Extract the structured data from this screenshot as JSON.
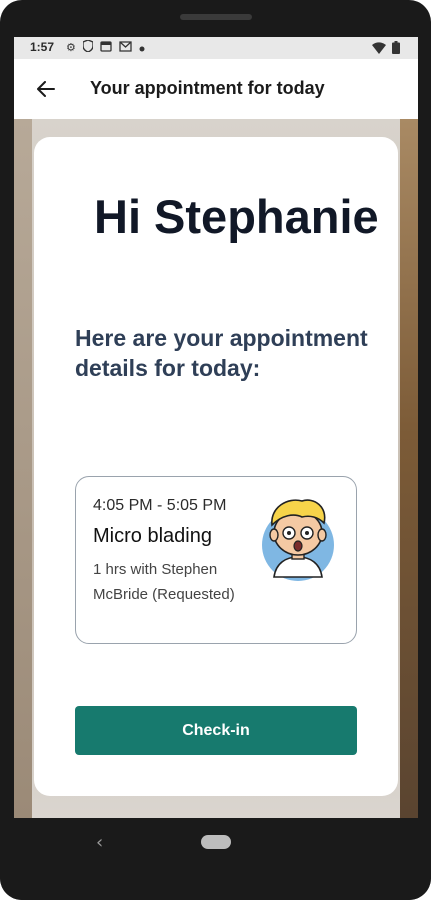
{
  "status_bar": {
    "time": "1:57",
    "left_icons": [
      "settings-icon",
      "shield-icon",
      "calendar-icon",
      "gmail-icon",
      "dot-icon"
    ],
    "right_icons": [
      "wifi-icon",
      "battery-icon"
    ]
  },
  "app_bar": {
    "title": "Your appointment for today",
    "back_icon": "arrow-left-icon"
  },
  "greeting": {
    "text": "Hi Stephanie",
    "subtitle": "Here are your appointment details for today:"
  },
  "appointment": {
    "time_range": "4:05 PM - 5:05 PM",
    "service": "Micro blading",
    "details": "1 hrs with Stephen McBride (Requested)",
    "avatar_icon": "cartoon-avatar-icon"
  },
  "actions": {
    "checkin_label": "Check-in"
  },
  "nav_bar": {
    "back_icon": "nav-back-icon",
    "home_icon": "nav-home-icon"
  },
  "colors": {
    "accent": "#177a6e",
    "heading": "#111827",
    "subheading": "#2f3f57"
  }
}
